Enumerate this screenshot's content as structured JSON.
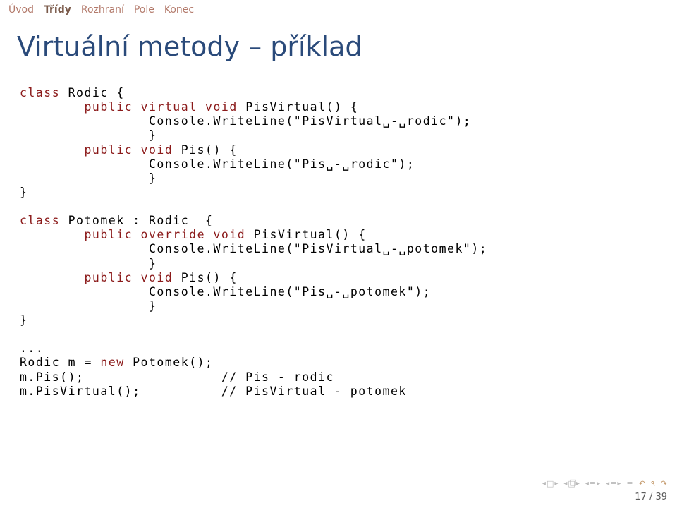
{
  "nav": {
    "items": [
      {
        "label": "Úvod",
        "active": false
      },
      {
        "label": "Třídy",
        "active": true
      },
      {
        "label": "Rozhraní",
        "active": false
      },
      {
        "label": "Pole",
        "active": false
      },
      {
        "label": "Konec",
        "active": false
      }
    ]
  },
  "title": "Virtuální metody – příklad",
  "code": {
    "k_class": "class",
    "k_public": "public",
    "k_virtual": "virtual",
    "k_void": "void",
    "k_override": "override",
    "k_new": "new",
    "id_Rodic": "Rodic",
    "id_Potomek": "Potomek",
    "id_PisVirtual": "PisVirtual",
    "id_Pis": "Pis",
    "id_Console": "Console",
    "id_WriteLine": "WriteLine",
    "str_pv_rodic": "\"PisVirtual␣-␣rodic\"",
    "str_pis_rodic": "\"Pis␣-␣rodic\"",
    "str_pv_potomek": "\"PisVirtual␣-␣potomek\"",
    "str_pis_potomek": "\"Pis␣-␣potomek\"",
    "lbrace": "{",
    "rbrace": "}",
    "colon": ":",
    "dots": "...",
    "var_m": "m",
    "eq": "=",
    "comment1": "// Pis - rodic",
    "comment2": "// PisVirtual - potomek",
    "call1": "m.Pis();",
    "call2": "m.PisVirtual();",
    "decl": "Rodic m = ",
    "new_potomek": "Potomek();"
  },
  "page": {
    "current": "17",
    "total": "39",
    "sep": " / "
  }
}
